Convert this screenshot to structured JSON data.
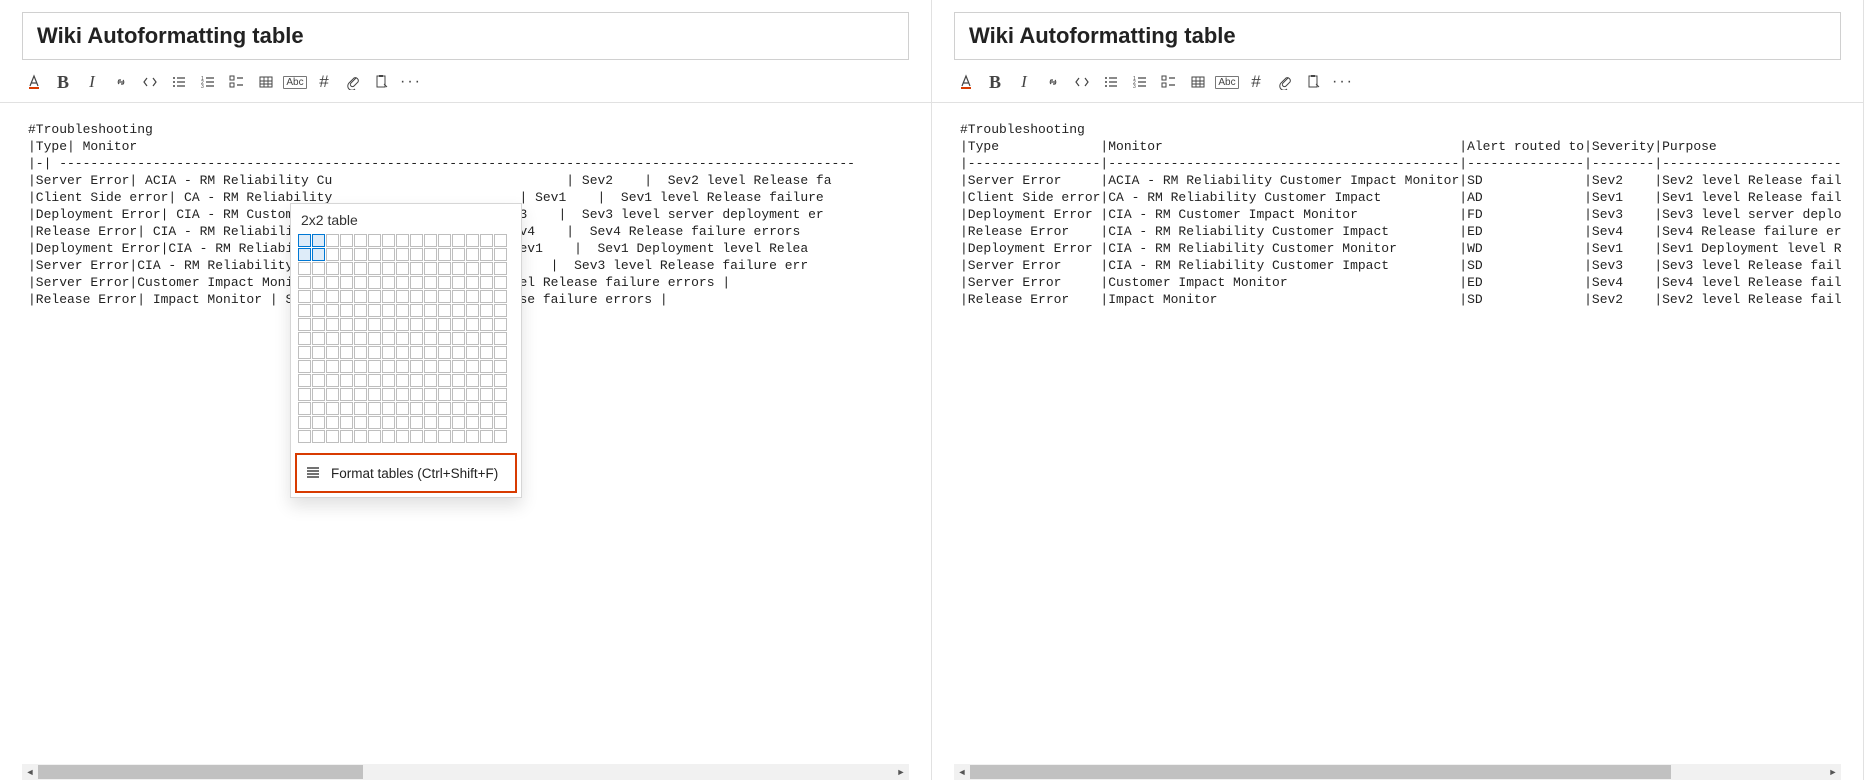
{
  "left": {
    "title": "Wiki Autoformatting table",
    "content": "#Troubleshooting\n|Type| Monitor\n|-| ------------------------------------------------------------------------------------------------------\n|Server Error| ACIA - RM Reliability Cu                              | Sev2    |  Sev2 level Release fa\n|Client Side error| CA - RM Reliability                        | Sev1    |  Sev1 level Release failure\n|Deployment Error| CIA - RM Customer Im                       v3    |  Sev3 level server deployment er\n|Release Error| CIA - RM Reliability Cu                      Sev4    |  Sev4 Release failure errors\n|Deployment Error|CIA - RM Reliability                        Sev1    |  Sev1 Deployment level Relea\n|Server Error|CIA - RM Reliability Cust                      v3    |  Sev3 level Release failure err\n|Server Error|Customer Impact Monitor                       level Release failure errors |\n|Release Error| Impact Monitor | SD                        elease failure errors |",
    "popup": {
      "title": "2x2 table",
      "format_label": "Format tables (Ctrl+Shift+F)"
    },
    "scroll": {
      "thumb_left": 0,
      "thumb_width": 38
    }
  },
  "right": {
    "title": "Wiki Autoformatting table",
    "content": "#Troubleshooting\n|Type             |Monitor                                      |Alert routed to|Severity|Purpose\n|-----------------|---------------------------------------------|---------------|--------|------------------------\n|Server Error     |ACIA - RM Reliability Customer Impact Monitor|SD             |Sev2    |Sev2 level Release fail\n|Client Side error|CA - RM Reliability Customer Impact          |AD             |Sev1    |Sev1 level Release fail\n|Deployment Error |CIA - RM Customer Impact Monitor             |FD             |Sev3    |Sev3 level server deplo\n|Release Error    |CIA - RM Reliability Customer Impact         |ED             |Sev4    |Sev4 Release failure er\n|Deployment Error |CIA - RM Reliability Customer Monitor        |WD             |Sev1    |Sev1 Deployment level R\n|Server Error     |CIA - RM Reliability Customer Impact         |SD             |Sev3    |Sev3 level Release fail\n|Server Error     |Customer Impact Monitor                      |ED             |Sev4    |Sev4 level Release fail\n|Release Error    |Impact Monitor                               |SD             |Sev2    |Sev2 level Release fail",
    "scroll": {
      "thumb_left": 0,
      "thumb_width": 82
    }
  },
  "toolbar_icons": [
    "font",
    "bold",
    "italic",
    "link",
    "code",
    "bullet",
    "numbered",
    "checklist",
    "table",
    "mention",
    "hash",
    "attach",
    "paste",
    "more"
  ]
}
